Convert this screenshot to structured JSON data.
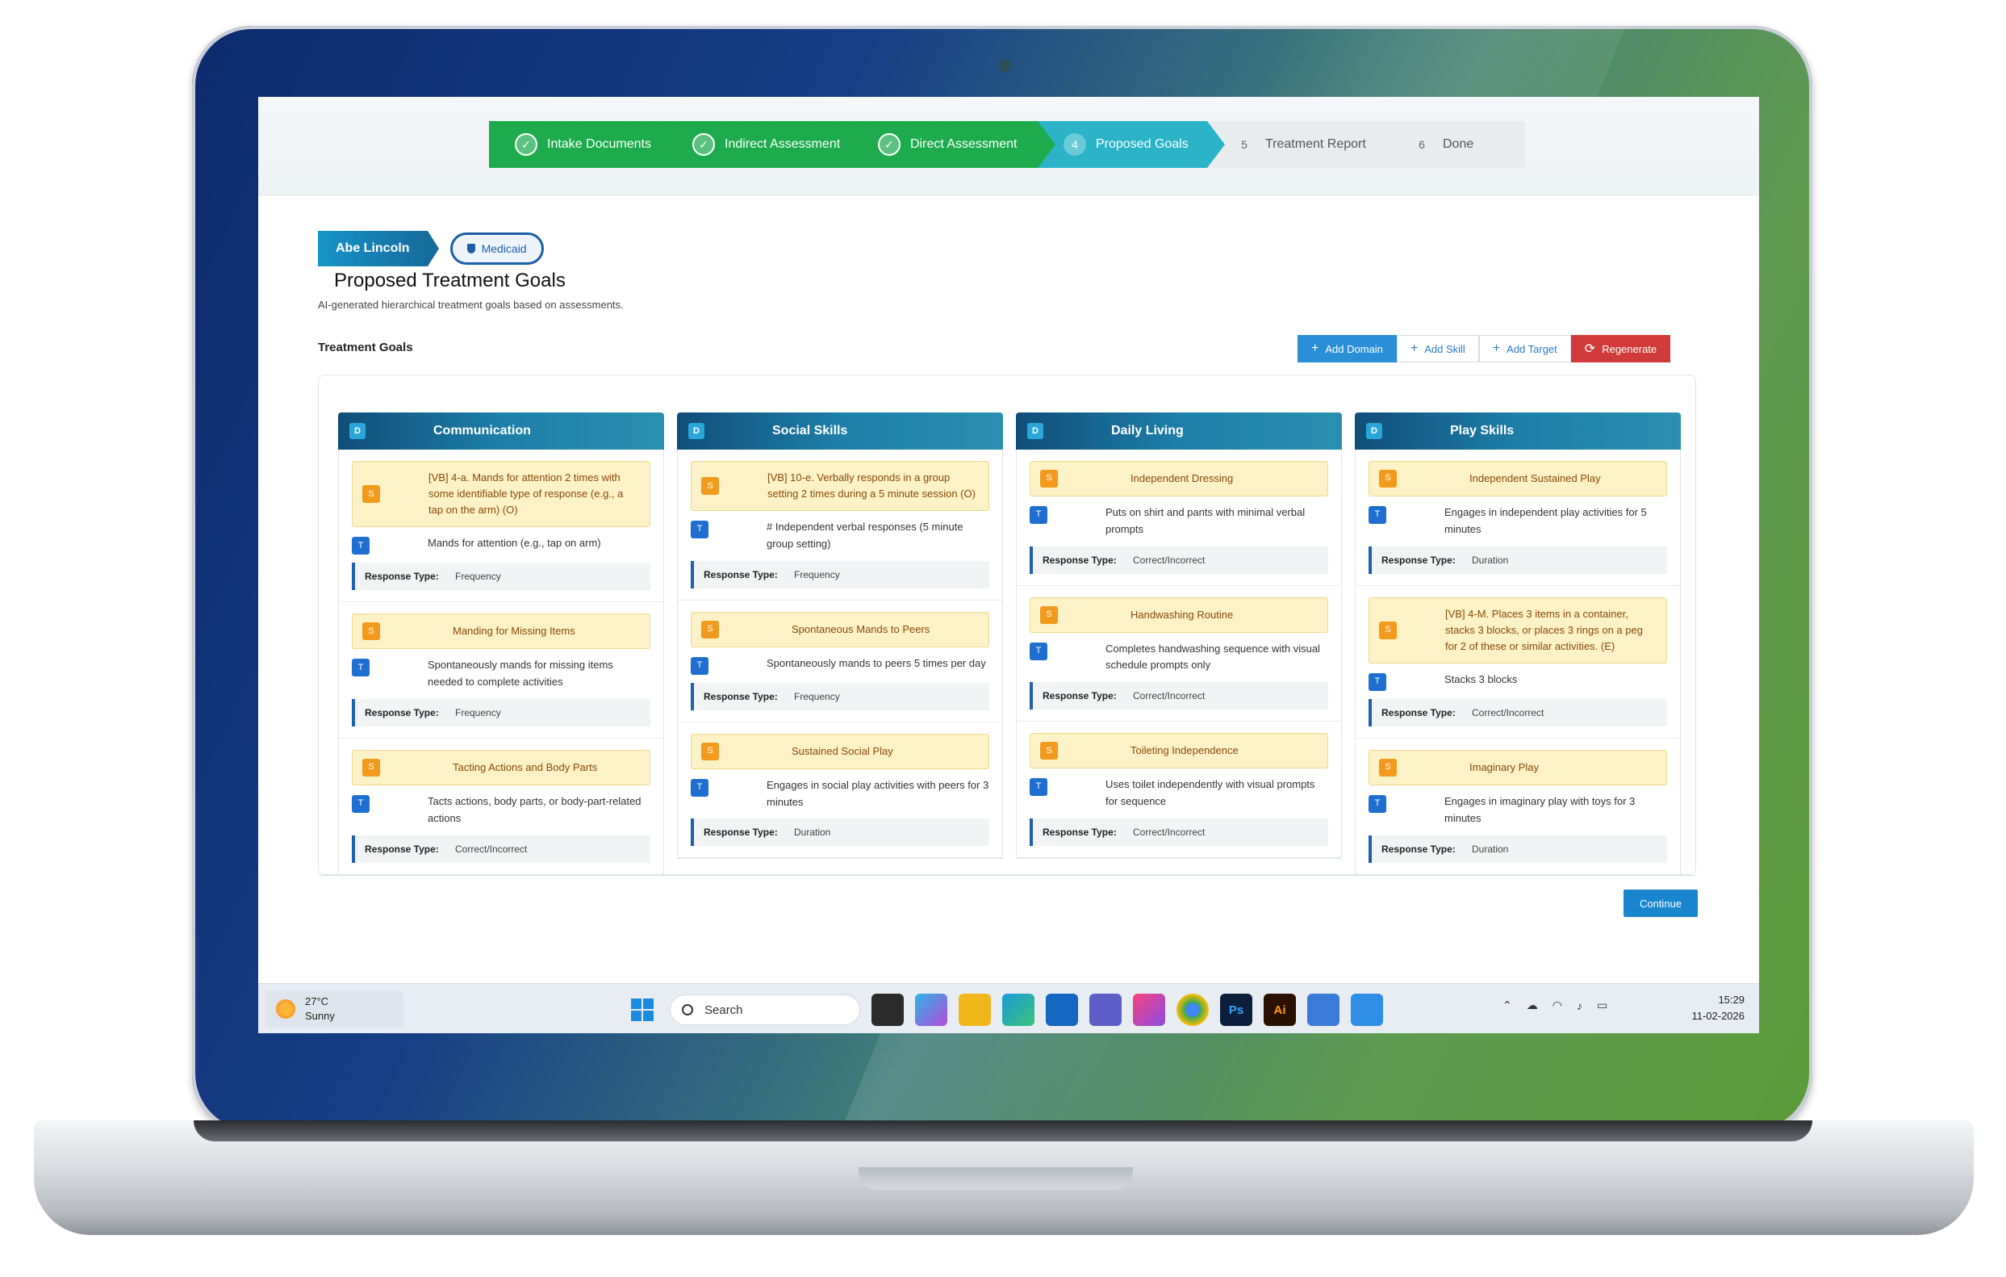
{
  "stepper": [
    {
      "label": "Intake Documents",
      "state": "done",
      "marker": "✓"
    },
    {
      "label": "Indirect Assessment",
      "state": "done",
      "marker": "✓"
    },
    {
      "label": "Direct Assessment",
      "state": "done",
      "marker": "✓"
    },
    {
      "label": "Proposed Goals",
      "state": "current",
      "marker": "4"
    },
    {
      "label": "Treatment Report",
      "state": "todo",
      "marker": "5"
    },
    {
      "label": "Done",
      "state": "todo",
      "marker": "6"
    }
  ],
  "patient": {
    "name": "Abe Lincoln",
    "insurance": "Medicaid"
  },
  "page": {
    "title": "Proposed Treatment Goals",
    "subtitle": "AI-generated hierarchical treatment goals based on assessments.",
    "section": "Treatment Goals"
  },
  "actions": {
    "add_domain": "Add Domain",
    "add_skill": "Add Skill",
    "add_target": "Add Target",
    "regenerate": "Regenerate"
  },
  "markers": {
    "domain": "D",
    "skill": "S",
    "target": "T",
    "response_label": "Response Type:"
  },
  "domains": [
    {
      "name": "Communication",
      "skills": [
        {
          "skill": "[VB] 4-a. Mands for attention 2 times with some identifiable type of response (e.g., a tap on the arm) (O)",
          "target": "Mands for attention (e.g., tap on arm)",
          "response": "Frequency"
        },
        {
          "skill": "Manding for Missing Items",
          "target": "Spontaneously mands for missing items needed to complete activities",
          "response": "Frequency"
        },
        {
          "skill": "Tacting Actions and Body Parts",
          "target": "Tacts actions, body parts, or body-part-related actions",
          "response": "Correct/Incorrect"
        }
      ]
    },
    {
      "name": "Social Skills",
      "skills": [
        {
          "skill": "[VB] 10-e. Verbally responds in a group setting 2 times during a 5 minute session (O)",
          "target": "# Independent verbal responses (5 minute group setting)",
          "response": "Frequency"
        },
        {
          "skill": "Spontaneous Mands to Peers",
          "target": "Spontaneously mands to peers 5 times per day",
          "response": "Frequency"
        },
        {
          "skill": "Sustained Social Play",
          "target": "Engages in social play activities with peers for 3 minutes",
          "response": "Duration"
        }
      ]
    },
    {
      "name": "Daily Living",
      "skills": [
        {
          "skill": "Independent Dressing",
          "target": "Puts on shirt and pants with minimal verbal prompts",
          "response": "Correct/Incorrect"
        },
        {
          "skill": "Handwashing Routine",
          "target": "Completes handwashing sequence with visual schedule prompts only",
          "response": "Correct/Incorrect"
        },
        {
          "skill": "Toileting Independence",
          "target": "Uses toilet independently with visual prompts for sequence",
          "response": "Correct/Incorrect"
        }
      ]
    },
    {
      "name": "Play Skills",
      "skills": [
        {
          "skill": "Independent Sustained Play",
          "target": "Engages in independent play activities for 5 minutes",
          "response": "Duration"
        },
        {
          "skill": "[VB] 4-M. Places 3 items in a container, stacks 3 blocks, or places 3 rings on a peg for 2 of these or similar activities. (E)",
          "target": "Stacks 3 blocks",
          "response": "Correct/Incorrect"
        },
        {
          "skill": "Imaginary Play",
          "target": "Engages in imaginary play with toys for 3 minutes",
          "response": "Duration"
        }
      ]
    }
  ],
  "continue_label": "Continue",
  "taskbar": {
    "weather_temp": "27°C",
    "weather_desc": "Sunny",
    "search": "Search",
    "time": "15:29",
    "date": "11-02-2026"
  },
  "colors": {
    "done": "#1dab4e",
    "current": "#2bb3c8",
    "skill_bg": "#fdf1c7",
    "target_badge": "#1f6fd1",
    "regenerate": "#d13b3b"
  }
}
